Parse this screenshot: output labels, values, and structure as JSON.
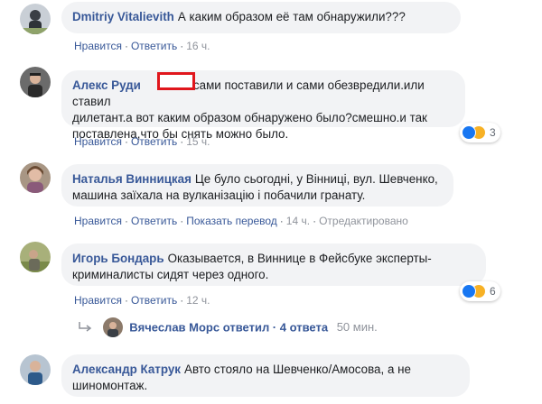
{
  "comments": [
    {
      "author": "Dmitriy Vitalievith",
      "text": "А каким образом её там обнаружили???",
      "like": "Нравится",
      "reply": "Ответить",
      "time": "16 ч."
    },
    {
      "author": "Алекс Руди",
      "text_line1": "сами поставили и сами обезвредили.или ставил",
      "text_line2": "дилетант.а вот каким образом обнаружено было?смешно.и так",
      "text_line3": "поставлена,что бы снять можно было.",
      "like": "Нравится",
      "reply": "Ответить",
      "time": "15 ч.",
      "reaction_count": "3"
    },
    {
      "author": "Наталья Винницкая",
      "text_line1": "Це було сьогодні, у Вінниці, вул. Шевченко,",
      "text_line2": "машина заїхала на вулканізацію і побачили гранату.",
      "like": "Нравится",
      "reply": "Ответить",
      "translate": "Показать перевод",
      "time": "14 ч.",
      "edited": "Отредактировано"
    },
    {
      "author": "Игорь Бондарь",
      "text_line1": "Оказывается, в Виннице в Фейсбуке эксперты-",
      "text_line2": "криминалисты сидят через одного.",
      "like": "Нравится",
      "reply": "Ответить",
      "time": "12 ч.",
      "reaction_count": "6"
    },
    {
      "author": "Александр Катрук",
      "text_line1": "Авто стояло на Шевченко/Амосова, а не",
      "text_line2": "шиномонтаж."
    }
  ],
  "reply_summary": {
    "name": "Вячеслав Морс",
    "verb": "ответил · 4 ответа",
    "time": "50 мин."
  },
  "colors": {
    "link": "#385898",
    "bubble": "#f2f3f5",
    "meta": "#606770",
    "redaction": "#e0161c"
  }
}
